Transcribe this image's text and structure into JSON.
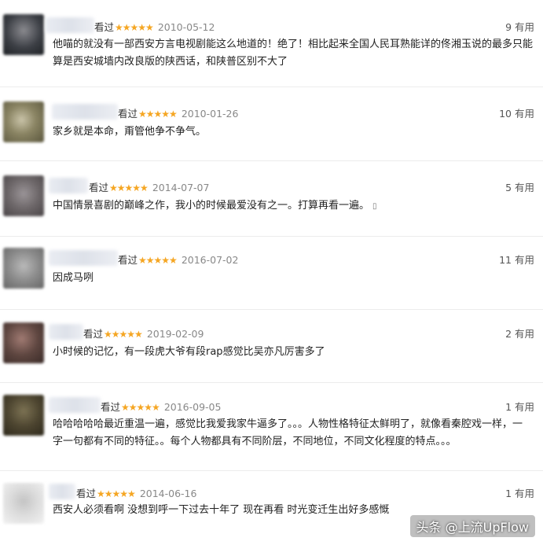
{
  "comments": [
    {
      "label": "看过",
      "stars": "★★★★★",
      "date": "2010-05-12",
      "votes": "9 有用",
      "lines": [
        "他喵的就没有一部西安方言电视剧能这么地道的！绝了！相比起来全国人民耳熟能详的佟湘玉说的最多只能",
        "算是西安城墙内改良版的陕西话，和陕普区别不大了"
      ]
    },
    {
      "label": "看过",
      "stars": "★★★★★",
      "date": "2010-01-26",
      "votes": "10 有用",
      "lines": [
        "家乡就是本命，甭管他争不争气。"
      ]
    },
    {
      "label": "看过",
      "stars": "★★★★★",
      "date": "2014-07-07",
      "votes": "5 有用",
      "lines": [
        "中国情景喜剧的巅峰之作，我小的时候最爱没有之一。打算再看一遍。"
      ],
      "icon": "mobile-phone-icon",
      "icon_glyph": "▯"
    },
    {
      "label": "看过",
      "stars": "★★★★★",
      "date": "2016-07-02",
      "votes": "11 有用",
      "lines": [
        "因成马咧"
      ]
    },
    {
      "label": "看过",
      "stars": "★★★★★",
      "date": "2019-02-09",
      "votes": "2 有用",
      "lines": [
        "小时候的记忆，有一段虎大爷有段rap感觉比吴亦凡厉害多了"
      ]
    },
    {
      "label": "看过",
      "stars": "★★★★★",
      "date": "2016-09-05",
      "votes": "1 有用",
      "lines": [
        "哈哈哈哈哈最近重温一遍，感觉比我爱我家牛逼多了。。。人物性格特征太鲜明了，就像看秦腔戏一样，一",
        "字一句都有不同的特征。。每个人物都具有不同阶层，不同地位，不同文化程度的特点。。。"
      ]
    },
    {
      "label": "看过",
      "stars": "★★★★★",
      "date": "2014-06-16",
      "votes": "1 有用",
      "lines": [
        "西安人必须看啊 没想到呼一下过去十年了 现在再看 时光变迁生出好多感慨"
      ]
    }
  ],
  "watermark": "头条 @上流UpFlow",
  "colors": {
    "star": "#f5a623",
    "separator": "#ececec"
  }
}
